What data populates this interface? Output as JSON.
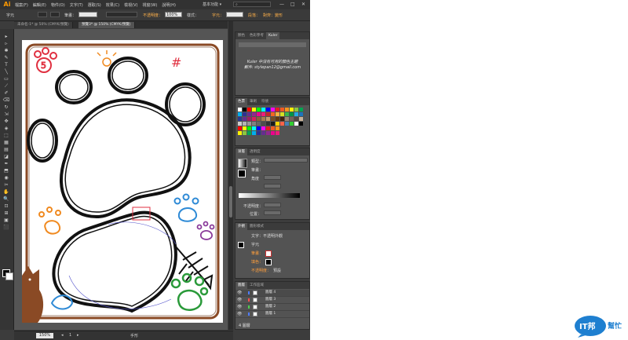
{
  "menubar": {
    "logo": "Ai",
    "items": [
      "檔案(F)",
      "編輯(E)",
      "物件(O)",
      "文字(T)",
      "選取(S)",
      "效果(C)",
      "檢視(V)",
      "視窗(W)",
      "說明(H)"
    ],
    "workspace": "基本功能 ▾",
    "search_placeholder": "",
    "window_buttons": [
      "—",
      "□",
      "✕"
    ]
  },
  "control": {
    "label_text": "字元",
    "stroke_label": "筆畫：",
    "stroke_value": "",
    "opacity_label": "不透明度：",
    "opacity_value": "100%",
    "style_label": "樣式：",
    "char_link": "字元：",
    "para_link": "段落：",
    "font_value": "",
    "size_value": "",
    "align_label": "對齊：",
    "transform_label": "變形"
  },
  "doc_tabs": [
    {
      "label": "未命名-1* @ 50% (CMYK/預覽)",
      "active": false
    },
    {
      "label": "預覽3* @ 150% (CMYK/預覽)",
      "active": true
    }
  ],
  "tools": [
    "▸",
    "▹",
    "✱",
    "✎",
    "T",
    "╲",
    "▭",
    "⟋",
    "✐",
    "⌫",
    "↻",
    "⇲",
    "✥",
    "◈",
    "⬚",
    "▦",
    "▤",
    "◪",
    "✒",
    "⬒",
    "◉",
    "✂",
    "✋",
    "🔍",
    "⊡",
    "⊞",
    "▣",
    "⬛"
  ],
  "status": {
    "zoom": "150%",
    "label": "手形",
    "page": "1"
  },
  "kuler_panel": {
    "tabs": [
      "顏色",
      "色彩參考",
      "Kuler"
    ],
    "line1": "Kuler 中沒有可用的顏色主題",
    "line2": "郵件: stylepan12@gmail.com"
  },
  "swatches_panel": {
    "tabs": [
      "色票",
      "筆刷",
      "符號"
    ]
  },
  "gradient_panel": {
    "tabs": [
      "漸層",
      "透明度"
    ],
    "type_label": "類型：",
    "stroke_label": "筆畫：",
    "angle_label": "角度",
    "opacity_label": "不透明度：",
    "location_label": "位置："
  },
  "appearance_panel": {
    "tabs": [
      "外觀",
      "圖形樣式"
    ],
    "title": "文字：不透明外觀",
    "char_label": "字元",
    "stroke_label": "筆畫：",
    "fill_label": "填色：",
    "opacity_label": "不透明度：",
    "opacity_value": "預設"
  },
  "layers_panel": {
    "tabs": [
      "圖層",
      "工作區域"
    ],
    "layers": [
      {
        "name": "圖層 4",
        "color": "#4f7cff",
        "selected": true
      },
      {
        "name": "圖層 3",
        "color": "#ff4f4f",
        "selected": false
      },
      {
        "name": "圖層 2",
        "color": "#4fd04f",
        "selected": false
      },
      {
        "name": "圖層 1",
        "color": "#4f7cff",
        "selected": false
      }
    ],
    "footer": "4 圖層"
  },
  "colors": {
    "accent": "#ff9a00",
    "brown": "#8a4a25",
    "blue": "#2e8ad6",
    "green": "#2a9a3a",
    "orange": "#f08a20",
    "purple": "#8a3a9a",
    "red": "#e03040"
  },
  "artwork": {
    "number_text": "5",
    "hash_text": "#",
    "sun_text": "☼"
  },
  "watermark": {
    "text1": "IT邦",
    "text2": "幫忙"
  }
}
